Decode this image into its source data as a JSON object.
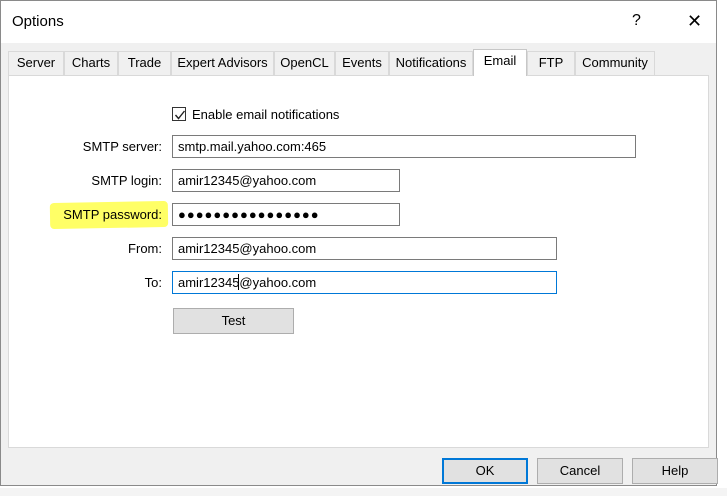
{
  "window": {
    "title": "Options",
    "help_label": "?",
    "close_label": "✕"
  },
  "tabs": [
    {
      "label": "Server"
    },
    {
      "label": "Charts"
    },
    {
      "label": "Trade"
    },
    {
      "label": "Expert Advisors"
    },
    {
      "label": "OpenCL"
    },
    {
      "label": "Events"
    },
    {
      "label": "Notifications"
    },
    {
      "label": "Email",
      "active": true
    },
    {
      "label": "FTP"
    },
    {
      "label": "Community"
    }
  ],
  "email": {
    "enable_label": "Enable email notifications",
    "enable_checked": true,
    "smtp_server_label": "SMTP server:",
    "smtp_server_value": "smtp.mail.yahoo.com:465",
    "smtp_login_label": "SMTP login:",
    "smtp_login_value": "amir12345@yahoo.com",
    "smtp_password_label": "SMTP password:",
    "smtp_password_value": "●●●●●●●●●●●●●●●●",
    "from_label": "From:",
    "from_value": "amir12345@yahoo.com",
    "to_label": "To:",
    "to_value": "amir12345@yahoo.com",
    "test_label": "Test"
  },
  "footer": {
    "ok_label": "OK",
    "cancel_label": "Cancel",
    "help_label": "Help"
  },
  "colors": {
    "highlight": "#ffff66",
    "accent": "#0078d7"
  }
}
